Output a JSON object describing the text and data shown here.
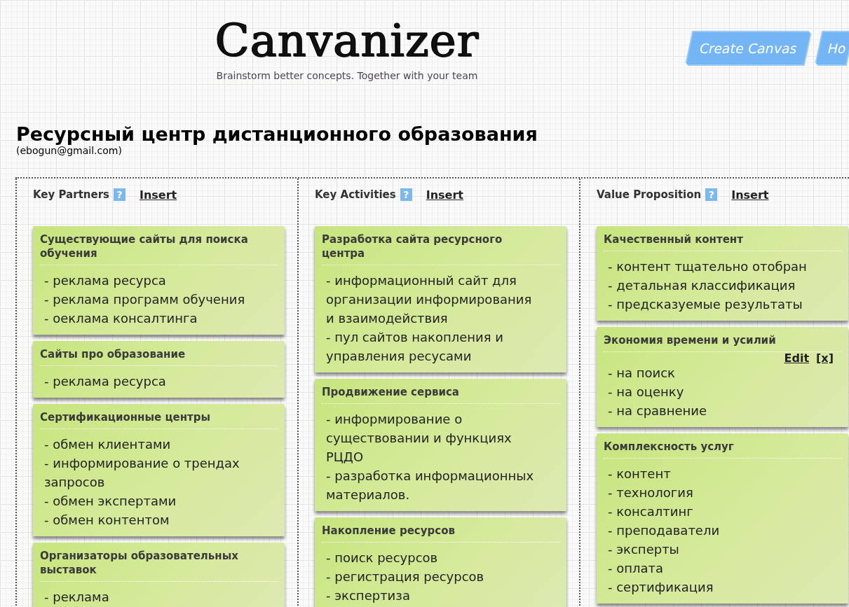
{
  "logo": {
    "text": "Canvanizer",
    "tagline": "Brainstorm better concepts. Together with your team"
  },
  "nav": [
    "Create Canvas",
    "Ho"
  ],
  "canvas": {
    "title": "Ресурсный центр дистанционного образования",
    "owner": "(ebogun@gmail.com)"
  },
  "columns": [
    {
      "title": "Key Partners",
      "help": "?",
      "insert": "Insert",
      "notes": [
        {
          "title": "Существующие сайты для поиска обучения",
          "items": [
            "- реклама ресурса",
            "- реклама программ обучения",
            "- оеклама консалтинга"
          ]
        },
        {
          "title": "Сайты про образование",
          "items": [
            "- реклама ресурса"
          ]
        },
        {
          "title": "Сертификационные центры",
          "items": [
            "- обмен клиентами",
            "- информирование о трендах запросов",
            "- обмен экспертами",
            "- обмен контентом"
          ]
        },
        {
          "title": "Организаторы образовательных выставок",
          "items": [
            "- реклама"
          ]
        }
      ]
    },
    {
      "title": "Key Activities",
      "help": "?",
      "insert": "Insert",
      "notes": [
        {
          "title": "Разработка сайта ресурсного центра",
          "items": [
            "- информационный сайт для организации информирования и взаимодействия",
            "- пул сайтов накопления и управления ресусами"
          ]
        },
        {
          "title": "Продвижение сервиса",
          "items": [
            "- информирование о существовании и функциях РЦДО",
            "- разработка информационных материалов."
          ]
        },
        {
          "title": "Накопление ресурсов",
          "items": [
            "- поиск ресурсов",
            "- регистрация ресурсов",
            "- экспертиза"
          ]
        }
      ]
    },
    {
      "title": "Value Proposition",
      "help": "?",
      "insert": "Insert",
      "notes": [
        {
          "title": "Качественный контент",
          "items": [
            "- контент тщательно отобран",
            "- детальная классификация",
            "- предсказуемые результаты"
          ]
        },
        {
          "title": "Экономия времени и усилий",
          "links": [
            "Edit",
            "[x]"
          ],
          "items": [
            "- на поиск",
            "- на оценку",
            "- на сравнение"
          ]
        },
        {
          "title": "Комплексность услуг",
          "items": [
            "- контент",
            "- технология",
            "- консалтинг",
            "- преподаватели",
            "- эксперты",
            "- оплата",
            "- сертификация"
          ]
        }
      ]
    }
  ]
}
